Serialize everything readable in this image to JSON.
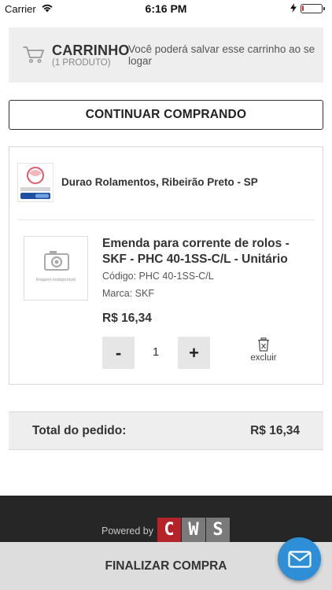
{
  "status_bar": {
    "carrier": "Carrier",
    "time": "6:16 PM",
    "battery_level": 0.1,
    "battery_color": "#e0262b"
  },
  "cart_header": {
    "icon": "cart-icon",
    "title": "CARRINHO",
    "count": "(1 PRODUTO)",
    "note": "Você poderá salvar esse carrinho ao se logar"
  },
  "continue_button": {
    "label": "CONTINUAR COMPRANDO"
  },
  "store": {
    "name": "Durao Rolamentos, Ribeirão Preto - SP",
    "logo_icon": "store-logo-icon"
  },
  "product": {
    "image_caption": "Imagem indisponível",
    "title": "Emenda para corrente de rolos - SKF - PHC 40-1SS-C/L - Unitário",
    "code": "Código: PHC 40-1SS-C/L",
    "brand": "Marca: SKF",
    "price": "R$ 16,34",
    "qty_minus_label": "-",
    "quantity": "1",
    "qty_plus_label": "+",
    "delete_label": "excluir"
  },
  "total": {
    "label": "Total do pedido:",
    "value": "R$ 16,34"
  },
  "footer": {
    "powered_by": "Powered by",
    "brand_letters": [
      "C",
      "W",
      "S"
    ],
    "brand_colors": [
      "#b4222a",
      "#7a7a7a",
      "#7a7a7a"
    ]
  },
  "finalize_button": {
    "label": "FINALIZAR COMPRA"
  },
  "chat_button": {
    "icon": "envelope-icon",
    "color": "#2f8fd6"
  }
}
